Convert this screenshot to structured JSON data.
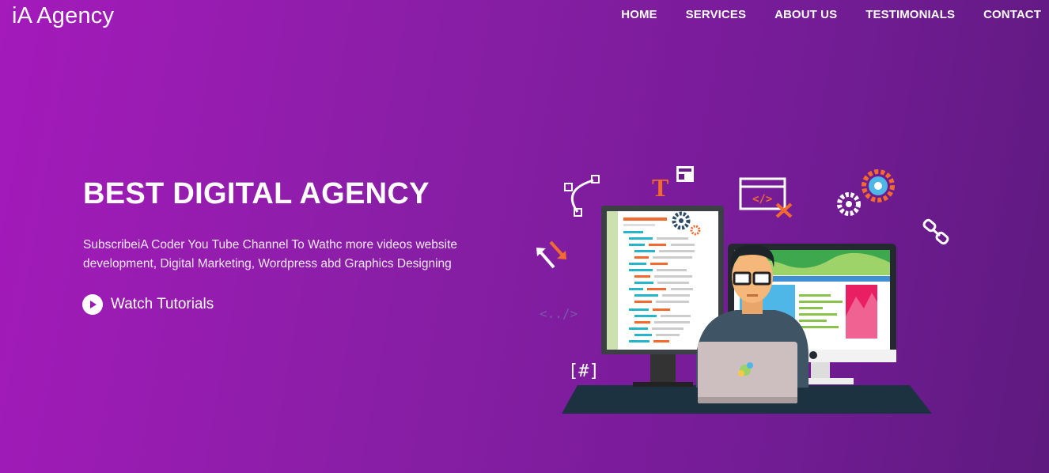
{
  "header": {
    "logo": "iA Agency",
    "nav": [
      "HOME",
      "SERVICES",
      "ABOUT US",
      "TESTIMONIALS",
      "CONTACT"
    ]
  },
  "hero": {
    "title": "BEST DIGITAL AGENCY",
    "text": "SubscribeiA Coder You Tube Channel To Wathc more videos website development, Digital Marketing, Wordpress abd Graphics Designing",
    "cta_label": "Watch Tutorials",
    "cta_icon": "play-circle-icon"
  },
  "illustration": {
    "letter_icon": "T",
    "code_tag": "</>",
    "hash_tag": "[#]",
    "dashed_tag": "<../>"
  },
  "colors": {
    "bg_start": "#a41abb",
    "bg_end": "#5e1a7f",
    "accent_orange": "#f26a2e",
    "accent_blue": "#4fb7e8"
  }
}
